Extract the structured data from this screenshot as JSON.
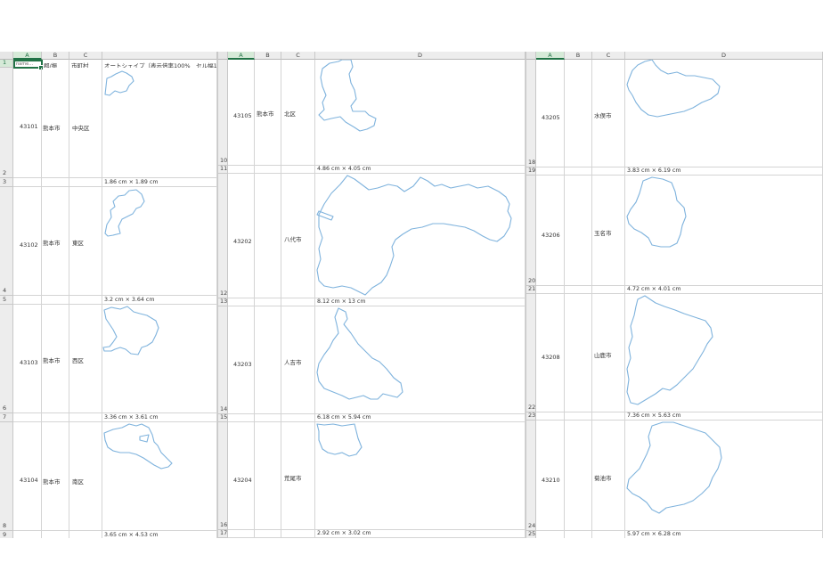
{
  "panel1": {
    "columns": [
      "A",
      "B",
      "C",
      ""
    ],
    "header_row": {
      "row_num": "1",
      "a1_value": "name…",
      "b1": "郡/振",
      "c1": "市町村",
      "d1": "オートシェイプ（表示倍率100%　セル幅1"
    },
    "rows": [
      {
        "top_num": "2",
        "code": "43101",
        "pref": "熊本市",
        "city": "中央区",
        "dim_num": "3",
        "dim": "1.86 cm × 1.89 cm"
      },
      {
        "top_num": "4",
        "code": "43102",
        "pref": "熊本市",
        "city": "東区",
        "dim_num": "5",
        "dim": "3.2 cm × 3.64 cm"
      },
      {
        "top_num": "6",
        "code": "43103",
        "pref": "熊本市",
        "city": "西区",
        "dim_num": "7",
        "dim": "3.36 cm × 3.61 cm"
      },
      {
        "top_num": "8",
        "code": "43104",
        "pref": "熊本市",
        "city": "南区",
        "dim_num": "9",
        "dim": "3.65 cm × 4.53 cm"
      }
    ]
  },
  "panel2": {
    "columns": [
      "A",
      "B",
      "C",
      "D"
    ],
    "rows": [
      {
        "top_num": "10",
        "code": "43105",
        "pref": "熊本市",
        "city": "北区",
        "dim_num": "11",
        "dim": "4.86 cm × 4.05 cm"
      },
      {
        "top_num": "12",
        "code": "43202",
        "pref": "",
        "city": "八代市",
        "dim_num": "13",
        "dim": "8.12 cm × 13 cm"
      },
      {
        "top_num": "14",
        "code": "43203",
        "pref": "",
        "city": "人吉市",
        "dim_num": "15",
        "dim": "6.18 cm × 5.94 cm"
      },
      {
        "top_num": "16",
        "code": "43204",
        "pref": "",
        "city": "荒尾市",
        "dim_num": "17",
        "dim": "2.92 cm × 3.02 cm"
      }
    ]
  },
  "panel3": {
    "columns": [
      "A",
      "B",
      "C",
      "D"
    ],
    "rows": [
      {
        "top_num": "18",
        "code": "43205",
        "pref": "",
        "city": "水俣市",
        "dim_num": "19",
        "dim": "3.83 cm × 6.19 cm"
      },
      {
        "top_num": "20",
        "code": "43206",
        "pref": "",
        "city": "玉名市",
        "dim_num": "21",
        "dim": "4.72 cm × 4.01 cm"
      },
      {
        "top_num": "22",
        "code": "43208",
        "pref": "",
        "city": "山鹿市",
        "dim_num": "23",
        "dim": "7.36 cm × 5.63 cm"
      },
      {
        "top_num": "24",
        "code": "43210",
        "pref": "",
        "city": "菊池市",
        "dim_num": "25",
        "dim": "5.97 cm × 6.28 cm"
      }
    ]
  },
  "colors": {
    "sheet_bg": "#ffffff",
    "header_bg": "#ededed",
    "grid": "#d4d4d4",
    "selection": "#217346",
    "shape_outline": "#7fb3dd"
  }
}
